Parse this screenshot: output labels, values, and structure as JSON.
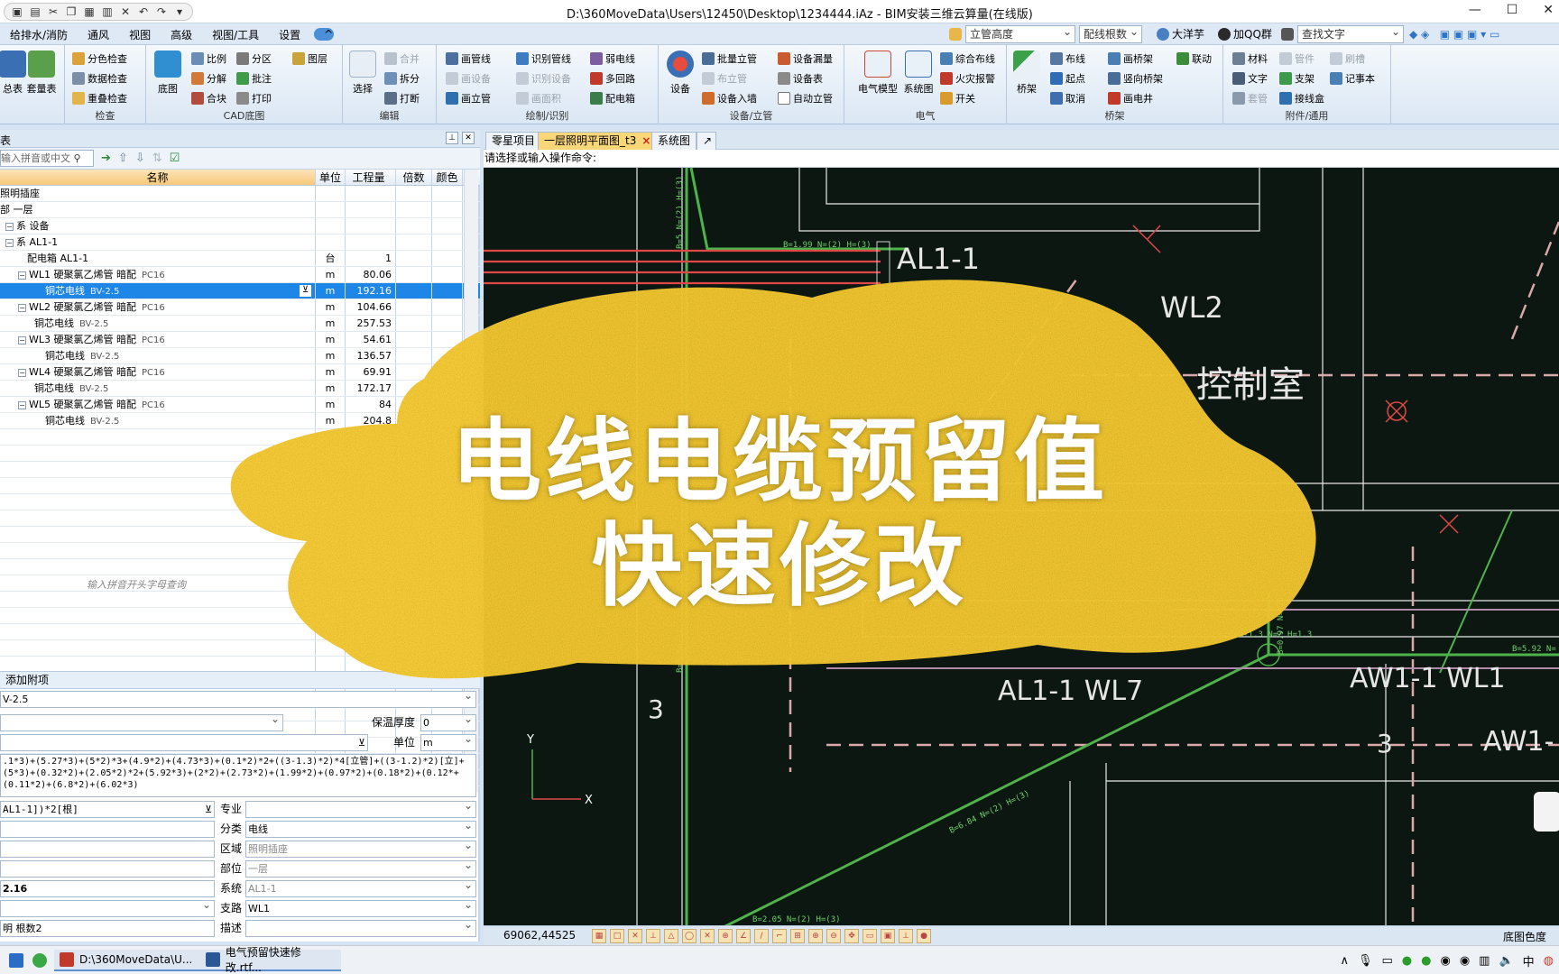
{
  "titlebar": {
    "title": "D:\\360MoveData\\Users\\12450\\Desktop\\1234444.iAz - BIM安装三维云算量(在线版)",
    "win_min": "—",
    "win_max": "☐",
    "win_close": "✕"
  },
  "menubar": {
    "items": [
      "给排水/消防",
      "通风",
      "视图",
      "高级",
      "视图/工具",
      "设置"
    ],
    "combo_standpipe": "立管高度",
    "combo_wirecount": "配线根数",
    "user": "大洋芋",
    "qq": "加QQ群",
    "search_text": "查找文字"
  },
  "ribbon": {
    "g_first": {
      "b1": "总表",
      "b2": "套量表"
    },
    "g_check": {
      "label": "检查",
      "a": "分色检查",
      "b": "数据检查",
      "c": "重叠检查"
    },
    "g_cad": {
      "label": "CAD底图",
      "big": "底图",
      "a": "比例",
      "b": "分区",
      "c": "图层",
      "d": "分解",
      "e": "批注",
      "f": "合块",
      "g": "打印"
    },
    "g_edit": {
      "label": "编辑",
      "big": "选择",
      "a": "合并",
      "b": "拆分",
      "c": "打断"
    },
    "g_draw": {
      "label": "绘制/识别",
      "a": "画管线",
      "b": "识别管线",
      "c": "弱电线",
      "d": "画设备",
      "e": "识别设备",
      "f": "多回路",
      "g": "画立管",
      "h": "画面积",
      "i": "配电箱"
    },
    "g_device": {
      "label": "设备/立管",
      "big": "设备",
      "a": "批量立管",
      "b": "设备漏量",
      "c": "布立管",
      "d": "设备表",
      "e": "设备入墙",
      "f": "自动立管"
    },
    "g_elec": {
      "label": "电气",
      "a": "电气模型",
      "b": "系统图",
      "c": "综合布线",
      "d": "火灾报警",
      "e": "开关"
    },
    "g_tray": {
      "label": "桥架",
      "big": "桥架",
      "a": "布线",
      "b": "画桥架",
      "c": "联动",
      "d": "起点",
      "e": "竖向桥架",
      "f": "取消",
      "g": "画电井"
    },
    "g_acc": {
      "label": "附件/通用",
      "a": "材料",
      "b": "管件",
      "c": "刷槽",
      "d": "文字",
      "e": "支架",
      "f": "记事本",
      "g": "套管",
      "h": "接线盒"
    }
  },
  "leftpanel": {
    "title": "表",
    "search_placeholder": "输入拼音或中文",
    "columns": [
      "名称",
      "单位",
      "工程量",
      "倍数",
      "颜色"
    ],
    "rows": [
      {
        "name": "照明插座",
        "unit": "",
        "qty": ""
      },
      {
        "name": "部 一层",
        "unit": "",
        "qty": ""
      },
      {
        "name": "系 设备",
        "unit": "",
        "qty": ""
      },
      {
        "name": "系 AL1-1",
        "unit": "",
        "qty": ""
      },
      {
        "name": "配电箱 AL1-1",
        "spec": "",
        "unit": "台",
        "qty": "1"
      },
      {
        "name": "WL1 硬聚氯乙烯管 暗配",
        "spec": "PC16",
        "unit": "m",
        "qty": "80.06"
      },
      {
        "name": "铜芯电线",
        "spec": "BV-2.5",
        "unit": "m",
        "qty": "192.16"
      },
      {
        "name": "WL2 硬聚氯乙烯管 暗配",
        "spec": "PC16",
        "unit": "m",
        "qty": "104.66"
      },
      {
        "name": "铜芯电线",
        "spec": "BV-2.5",
        "unit": "m",
        "qty": "257.53"
      },
      {
        "name": "WL3 硬聚氯乙烯管 暗配",
        "spec": "PC16",
        "unit": "m",
        "qty": "54.61"
      },
      {
        "name": "铜芯电线",
        "spec": "BV-2.5",
        "unit": "m",
        "qty": "136.57"
      },
      {
        "name": "WL4 硬聚氯乙烯管 暗配",
        "spec": "PC16",
        "unit": "m",
        "qty": "69.91"
      },
      {
        "name": "铜芯电线",
        "spec": "BV-2.5",
        "unit": "m",
        "qty": "172.17"
      },
      {
        "name": "WL5 硬聚氯乙烯管 暗配",
        "spec": "PC16",
        "unit": "m",
        "qty": "84"
      },
      {
        "name": "铜芯电线",
        "spec": "BV-2.5",
        "unit": "m",
        "qty": "204.8"
      }
    ],
    "hint": "输入拼音开头字母查询",
    "add_attachment": "添加附项",
    "spec_value": "V-2.5",
    "insulation_label": "保温厚度",
    "insulation_value": "0",
    "unit_label": "单位",
    "unit_value": "m",
    "formula": ".1*3)+(5.27*3)+(5*2)*3+(4.9*2)+(4.73*3)+(0.1*2)*2+((3-1.3)*2)*4[立管]+((3-1.2)*2)[立]+(5*3)+(0.32*2)+(2.05*2)*2+(5.92*3)+(2*2)+(2.73*2)+(1.99*2)+(0.97*2)+(0.18*2)+(0.12*+(0.11*2)+(6.8*2)+(6.02*3)",
    "count_expr": "AL1-1])*2[根]",
    "qty_value": "2.16",
    "desc_value": "明 根数2",
    "props": {
      "major_label": "专业",
      "major_value": "",
      "category_label": "分类",
      "category_value": "电线",
      "region_label": "区域",
      "region_value": "照明插座",
      "part_label": "部位",
      "part_value": "一层",
      "system_label": "系统",
      "system_value": "AL1-1",
      "branch_label": "支路",
      "branch_value": "WL1",
      "desc_label": "描述",
      "desc_value": ""
    }
  },
  "drawing": {
    "tabs": [
      "零星项目",
      "一层照明平面图_t3",
      "系统图"
    ],
    "command_prompt": "请选择或输入操作命令:",
    "labels": {
      "al11": "AL1-1",
      "wl2": "WL2",
      "room": "控制室",
      "al11wl7": "AL1-1 WL7",
      "aw11wl1": "AW1-1 WL1",
      "aw1": "AW1-",
      "n3a": "3",
      "n3b": "3",
      "y": "Y",
      "x": "X",
      "small1": "B=1.99 N=(2) H=(3)",
      "small2": "B=6.84 N=(2) H=(3)",
      "small3": "B=2.05 N=(2) H=(3)",
      "small4": "B=3-1.3 N=2 H=1.3",
      "small5": "B=5.92 N=",
      "small6": "B=5 N=(2) H=(3)",
      "small7": "B=0.97 N=(2)",
      "small8": "B=5 N=(3)"
    }
  },
  "statusbar": {
    "coords": "69062,44525",
    "right": "底图色度"
  },
  "taskbar": {
    "t1": "D:\\360MoveData\\U...",
    "t2": "电气预留快速修改.rtf..."
  },
  "overlay": {
    "line1": "电线电缆预留值",
    "line2": "快速修改"
  }
}
